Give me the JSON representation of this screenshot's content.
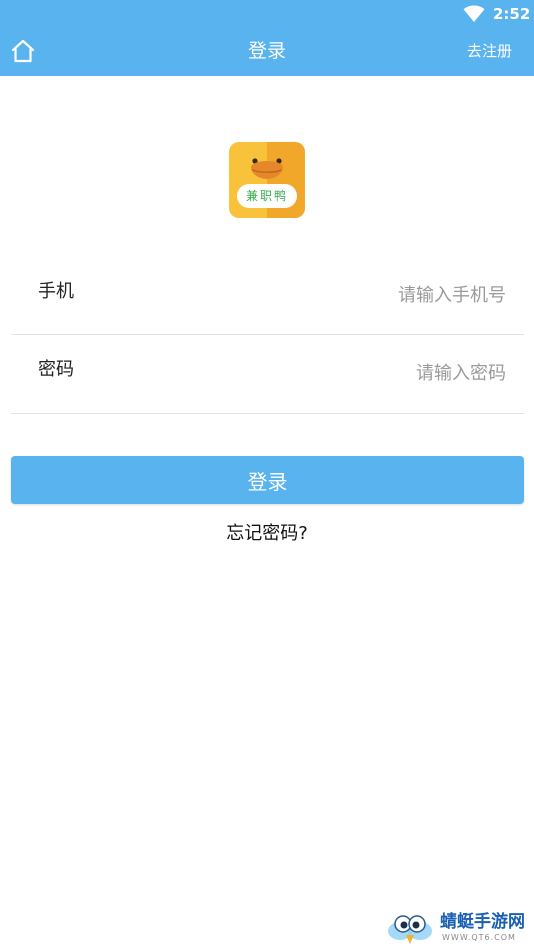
{
  "status_bar": {
    "time": "2:52",
    "wifi_icon": "wifi-icon"
  },
  "header": {
    "home_icon": "home-icon",
    "title": "登录",
    "register_label": "去注册",
    "background_color": "#58b3ee"
  },
  "logo": {
    "label": "兼职鸭",
    "icon": "duck-logo-icon"
  },
  "form": {
    "phone": {
      "label": "手机",
      "value": "",
      "placeholder": "请输入手机号"
    },
    "password": {
      "label": "密码",
      "value": "",
      "placeholder": "请输入密码"
    }
  },
  "actions": {
    "login_label": "登录",
    "forgot_label": "忘记密码?"
  },
  "watermark": {
    "name": "蜻蜓手游网",
    "url": "WWW.QT6.COM"
  },
  "colors": {
    "accent": "#58b3ee",
    "logo_orange": "#f6a623",
    "logo_green_text": "#3aaa52"
  }
}
